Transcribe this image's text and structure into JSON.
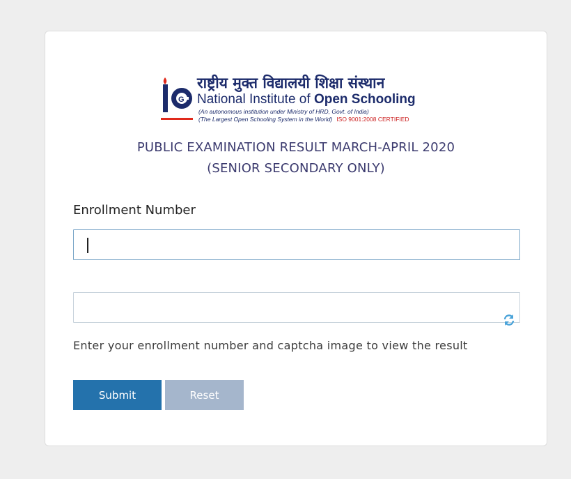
{
  "logo": {
    "hindi": "राष्ट्रीय मुक्त विद्यालयी शिक्षा संस्थान",
    "name_regular": "National Institute of ",
    "name_bold": "Open Schooling",
    "tagline1": "(An autonomous institution under Ministry of HRD, Govt. of India)",
    "tagline2": "(The Largest Open Schooling System in the World)",
    "iso": "ISO 9001:2008 CERTIFIED"
  },
  "header": {
    "line1": "PUBLIC EXAMINATION RESULT MARCH-APRIL 2020",
    "line2": "(SENIOR SECONDARY ONLY)"
  },
  "form": {
    "enrollment_label": "Enrollment Number",
    "enrollment_value": "",
    "captcha_value": "",
    "help_text": "Enter your enrollment number and captcha image to view the result",
    "submit_label": "Submit",
    "reset_label": "Reset"
  },
  "colors": {
    "title": "#3b3a6e",
    "submit_bg": "#2472ac",
    "reset_bg": "#a5b6cc",
    "refresh_icon": "#4aa3d9"
  }
}
